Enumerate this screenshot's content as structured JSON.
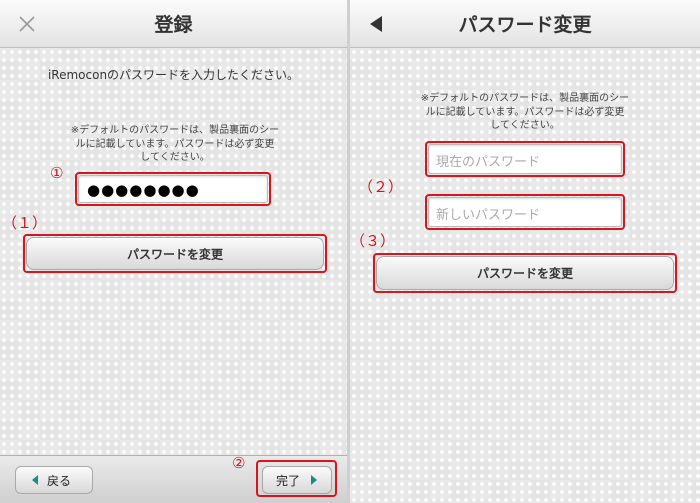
{
  "left": {
    "title": "登録",
    "instruction": "iRemoconのパスワードを入力したください。",
    "note_lines": [
      "※デフォルトのパスワードは、製品裏面のシー",
      "ルに記載しています。パスワードは必ず変更",
      "してください。"
    ],
    "password_value": "●●●●●●●●",
    "change_button_label": "パスワードを変更",
    "back_button_label": "戻る",
    "done_button_label": "完了"
  },
  "right": {
    "title": "パスワード変更",
    "note_lines": [
      "※デフォルトのパスワードは、製品裏面のシー",
      "ルに記載しています。パスワードは必ず変更",
      "してください。"
    ],
    "current_password_placeholder": "現在のパスワード",
    "new_password_placeholder": "新しいパスワード",
    "change_button_label": "パスワードを変更"
  },
  "annotations": {
    "circle1": "①",
    "circle2": "②",
    "paren1": "（１）",
    "paren2": "（２）",
    "paren3": "（３）"
  },
  "colors": {
    "annotation_red": "#d8141e",
    "arrow_teal": "#1d8a8a"
  },
  "icons": {
    "close": "close-icon",
    "back": "back-arrow-icon",
    "back_button": "triangle-left-icon",
    "done_button": "triangle-right-icon"
  }
}
